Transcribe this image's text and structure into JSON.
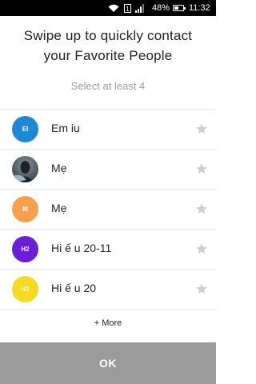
{
  "status_bar": {
    "battery": "48%",
    "battery_level": 0.48,
    "time": "11:32",
    "sim_label": "1"
  },
  "header": {
    "title_line1": "Swipe up to quickly contact",
    "title_line2": "your Favorite People",
    "subtitle": "Select at least 4"
  },
  "contacts": [
    {
      "initials": "EI",
      "name": "Em iu",
      "color": "#1e88d2",
      "photo": false
    },
    {
      "initials": "",
      "name": "Mẹ",
      "color": "#5a6770",
      "photo": true
    },
    {
      "initials": "M",
      "name": "Mẹ",
      "color": "#f6a04d",
      "photo": false
    },
    {
      "initials": "H2",
      "name": "Hi ế u 20-11",
      "color": "#6a1fd6",
      "photo": false
    },
    {
      "initials": "H2",
      "name": "Hi ế u 20",
      "color": "#f5da22",
      "photo": false
    }
  ],
  "more_label": "+ More",
  "ok_label": "OK",
  "colors": {
    "star": "#cfcfcf",
    "ok_bg": "#9b9b9b"
  }
}
